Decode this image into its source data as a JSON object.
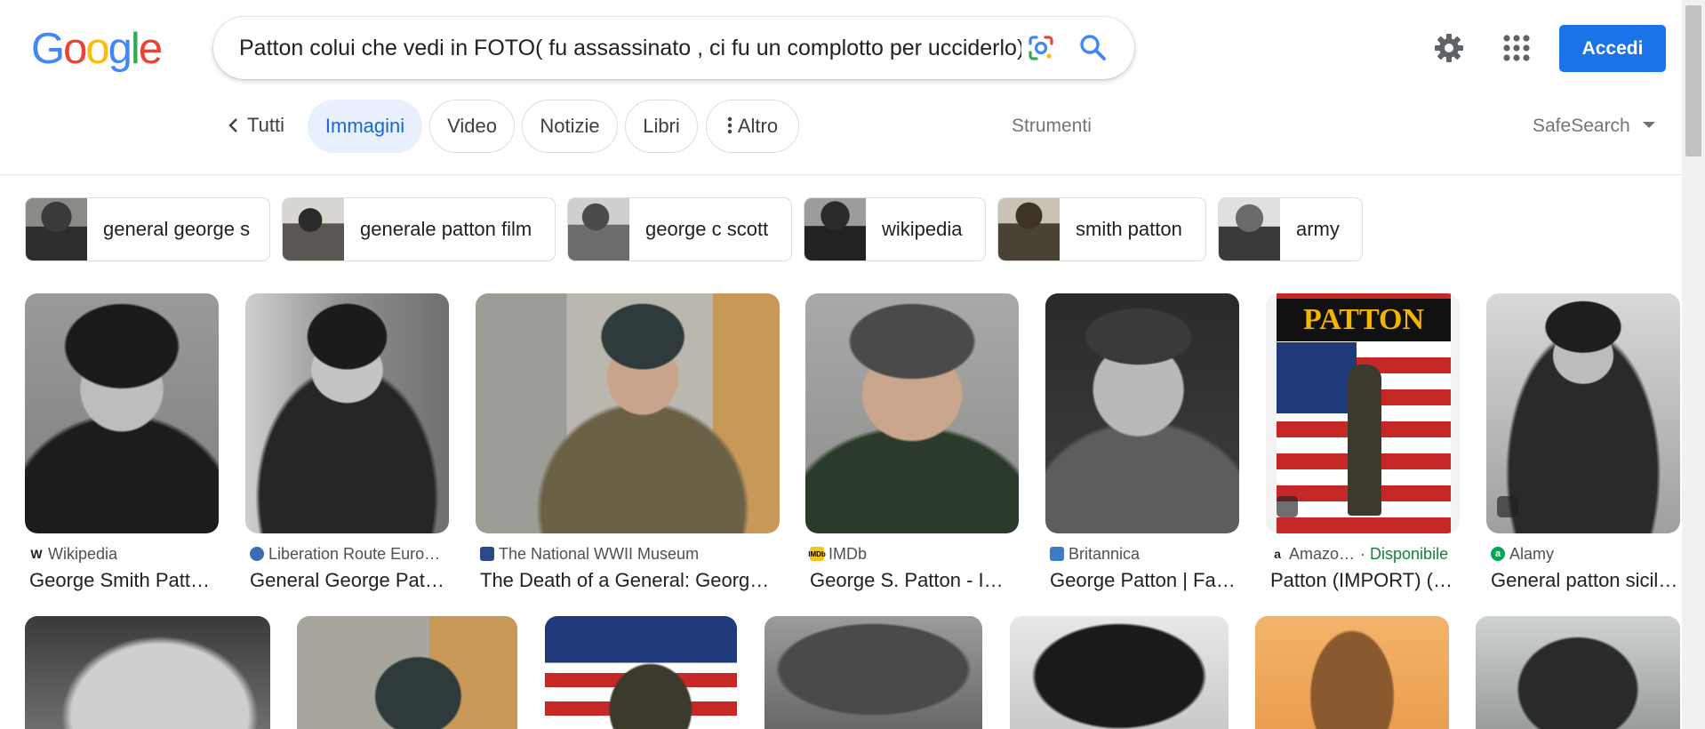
{
  "logo": {
    "letters": [
      "G",
      "o",
      "o",
      "g",
      "l",
      "e"
    ],
    "colors": [
      "#4285f4",
      "#ea4335",
      "#fbbc05",
      "#4285f4",
      "#34a853",
      "#ea4335"
    ]
  },
  "search": {
    "query": "Patton colui che vedi in FOTO( fu assassinato , ci fu un complotto per ucciderlo)"
  },
  "header": {
    "signin_label": "Accedi"
  },
  "tabs": {
    "all": "Tutti",
    "images": "Immagini",
    "video": "Video",
    "news": "Notizie",
    "books": "Libri",
    "more": "Altro",
    "tools": "Strumenti",
    "safesearch": "SafeSearch"
  },
  "chips": [
    {
      "label": "general george s"
    },
    {
      "label": "generale patton film"
    },
    {
      "label": "george c scott"
    },
    {
      "label": "wikipedia"
    },
    {
      "label": "smith patton"
    },
    {
      "label": "army"
    }
  ],
  "results": [
    {
      "source": "Wikipedia",
      "title": "George Smith Patto…"
    },
    {
      "source": "Liberation Route Euro…",
      "title": "General George Patton"
    },
    {
      "source": "The National WWII Museum",
      "title": "The Death of a General: George …"
    },
    {
      "source": "IMDb",
      "title": "George S. Patton - IM…"
    },
    {
      "source": "Britannica",
      "title": "George Patton | Fac…"
    },
    {
      "source": "Amazo…",
      "availability": "· Disponibile",
      "title": "Patton (IMPORT) (N…",
      "poster_title": "PATTON"
    },
    {
      "source": "Alamy",
      "title": "General patton sicil…"
    }
  ],
  "colors": {
    "accent": "#1a73e8",
    "active_tab_bg": "#e8f0fe",
    "active_tab_text": "#1967d2",
    "available_green": "#188038"
  }
}
